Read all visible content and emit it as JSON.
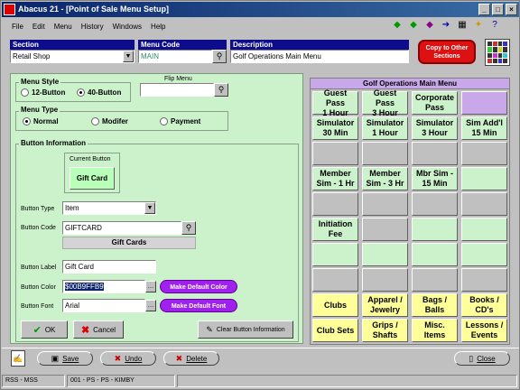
{
  "window": {
    "title": "Abacus 21 - [Point of Sale Menu Setup]"
  },
  "menu": [
    "File",
    "Edit",
    "Menu",
    "History",
    "Windows",
    "Help"
  ],
  "header": {
    "section_label": "Section",
    "section_value": "Retail Shop",
    "menu_code_label": "Menu Code",
    "menu_code_value": "MAIN",
    "description_label": "Description",
    "description_value": "Golf Operations Main Menu",
    "copy_button": "Copy to Other Sections"
  },
  "menu_style": {
    "title": "Menu Style",
    "option_12": "12-Button",
    "option_40": "40-Button",
    "flip_menu_label": "Flip Menu",
    "flip_menu_value": ""
  },
  "menu_type": {
    "title": "Menu Type",
    "normal": "Normal",
    "modifier": "Modifer",
    "payment": "Payment"
  },
  "button_info": {
    "title": "Button Information",
    "current_button_label": "Current Button",
    "current_button_value": "Gift Card",
    "button_type_label": "Button Type",
    "button_type_value": "Item",
    "button_code_label": "Button Code",
    "button_code_value": "GIFTCARD",
    "button_code_desc": "Gift Cards",
    "button_label_label": "Button Label",
    "button_label_value": "Gift Card",
    "button_color_label": "Button Color",
    "button_color_value": "$00B9FFB9",
    "button_font_label": "Button Font",
    "button_font_value": "Arial",
    "make_default_color": "Make Default Color",
    "make_default_font": "Make Default Font",
    "ok": "OK",
    "cancel": "Cancel",
    "clear": "Clear Button Information"
  },
  "grid": {
    "title": "Golf Operations Main Menu",
    "cells": [
      {
        "label": "Guest Pass\n1 Hour",
        "color": "#ccf2cc"
      },
      {
        "label": "Guest Pass\n3 Hour",
        "color": "#ccf2cc"
      },
      {
        "label": "Corporate\nPass",
        "color": "#ccf2cc"
      },
      {
        "label": "",
        "color": "#c8a8e8"
      },
      {
        "label": "Simulator\n30 Min",
        "color": "#ccf2cc"
      },
      {
        "label": "Simulator\n1 Hour",
        "color": "#ccf2cc"
      },
      {
        "label": "Simulator\n3 Hour",
        "color": "#ccf2cc"
      },
      {
        "label": "Sim Add'l\n15 Min",
        "color": "#ccf2cc"
      },
      {
        "label": "",
        "color": "#c0c0c0"
      },
      {
        "label": "",
        "color": "#c0c0c0"
      },
      {
        "label": "",
        "color": "#c0c0c0"
      },
      {
        "label": "",
        "color": "#c0c0c0"
      },
      {
        "label": "Member\nSim - 1 Hr",
        "color": "#ccf2cc"
      },
      {
        "label": "Member\nSim - 3 Hr",
        "color": "#ccf2cc"
      },
      {
        "label": "Mbr Sim -\n15 Min",
        "color": "#ccf2cc"
      },
      {
        "label": "",
        "color": "#ccf2cc"
      },
      {
        "label": "",
        "color": "#c0c0c0"
      },
      {
        "label": "",
        "color": "#c0c0c0"
      },
      {
        "label": "",
        "color": "#c0c0c0"
      },
      {
        "label": "",
        "color": "#c0c0c0"
      },
      {
        "label": "Initiation\nFee",
        "color": "#ccf2cc"
      },
      {
        "label": "",
        "color": "#c0c0c0"
      },
      {
        "label": "",
        "color": "#ccf2cc"
      },
      {
        "label": "",
        "color": "#ccf2cc"
      },
      {
        "label": "",
        "color": "#ccf2cc"
      },
      {
        "label": "",
        "color": "#ccf2cc"
      },
      {
        "label": "",
        "color": "#ccf2cc"
      },
      {
        "label": "",
        "color": "#ccf2cc"
      },
      {
        "label": "",
        "color": "#c0c0c0"
      },
      {
        "label": "",
        "color": "#c0c0c0"
      },
      {
        "label": "",
        "color": "#c0c0c0"
      },
      {
        "label": "",
        "color": "#c0c0c0"
      },
      {
        "label": "Clubs",
        "color": "#ffff99"
      },
      {
        "label": "Apparel /\nJewelry",
        "color": "#ffff99"
      },
      {
        "label": "Bags /\nBalls",
        "color": "#ffff99"
      },
      {
        "label": "Books /\nCD's",
        "color": "#ffff99"
      },
      {
        "label": "Club Sets",
        "color": "#ffff99"
      },
      {
        "label": "Grips /\nShafts",
        "color": "#ffff99"
      },
      {
        "label": "Misc.\nItems",
        "color": "#ffff99"
      },
      {
        "label": "Lessons /\nEvents",
        "color": "#ffff99"
      }
    ]
  },
  "footer": {
    "save": "Save",
    "undo": "Undo",
    "delete": "Delete",
    "close": "Close"
  },
  "status": {
    "left": "RSS - MSS",
    "mid": "001 - PS - PS - KIMBY"
  }
}
